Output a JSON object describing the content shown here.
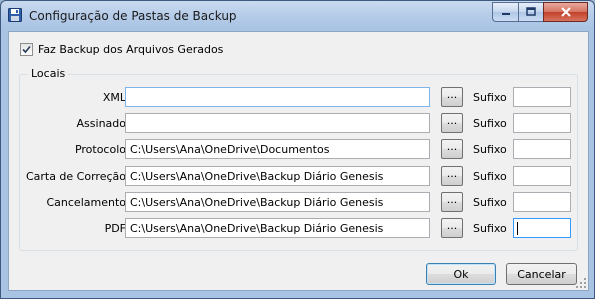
{
  "window": {
    "title": "Configuração de Pastas de Backup",
    "icon": "save-icon"
  },
  "options": {
    "backup_label": "Faz Backup dos Arquivos Gerados",
    "backup_checked": true
  },
  "locais": {
    "legend": "Locais",
    "browse_label": "...",
    "suffix_label": "Sufixo",
    "rows": [
      {
        "label": "XML",
        "path": "",
        "suffix": ""
      },
      {
        "label": "Assinado",
        "path": "",
        "suffix": ""
      },
      {
        "label": "Protocolo",
        "path": "C:\\Users\\Ana\\OneDrive\\Documentos",
        "suffix": ""
      },
      {
        "label": "Carta de Correção",
        "path": "C:\\Users\\Ana\\OneDrive\\Backup Diário Genesis",
        "suffix": ""
      },
      {
        "label": "Cancelamento",
        "path": "C:\\Users\\Ana\\OneDrive\\Backup Diário Genesis",
        "suffix": ""
      },
      {
        "label": "PDF",
        "path": "C:\\Users\\Ana\\OneDrive\\Backup Diário Genesis",
        "suffix": ""
      }
    ]
  },
  "buttons": {
    "ok": "Ok",
    "cancel": "Cancelar"
  }
}
